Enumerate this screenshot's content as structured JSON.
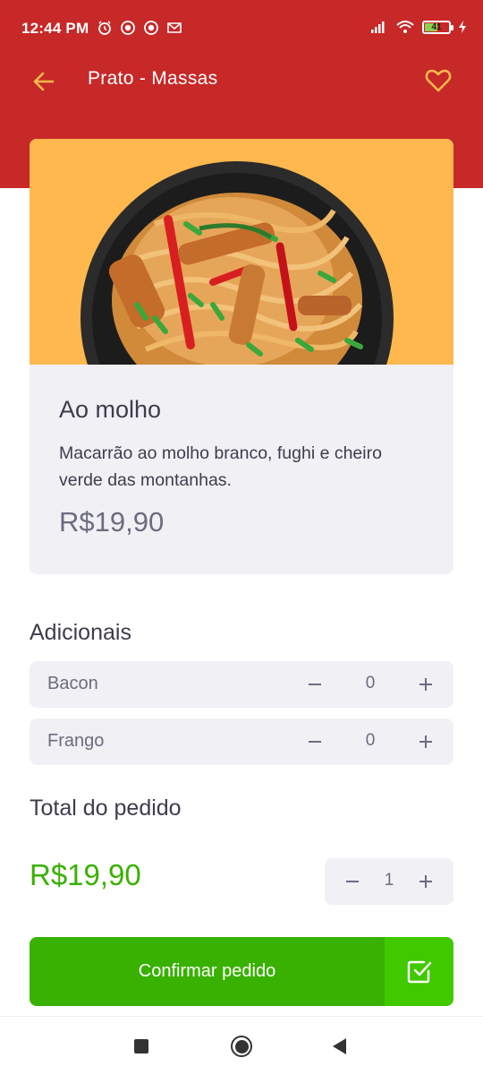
{
  "status_bar": {
    "time": "12:44 PM",
    "left_icons": [
      "alarm-icon",
      "vpn-icon",
      "vpn-icon",
      "gmail-icon"
    ],
    "right_icons": [
      "signal-icon",
      "wifi-icon",
      "battery-icon",
      "charging-icon"
    ],
    "battery_level": "41"
  },
  "header": {
    "title": "Prato - Massas",
    "back_icon": "arrow-left-icon",
    "favorite_icon": "heart-icon"
  },
  "product": {
    "image_alt": "pasta-dish-image",
    "name": "Ao molho",
    "description": "Macarrão ao molho branco, fughi e cheiro verde das montanhas.",
    "price": "R$19,90"
  },
  "extras": {
    "title": "Adicionais",
    "items": [
      {
        "label": "Bacon",
        "quantity": "0",
        "minus": "−",
        "plus": "+"
      },
      {
        "label": "Frango",
        "quantity": "0",
        "minus": "−",
        "plus": "+"
      }
    ]
  },
  "total": {
    "title": "Total do pedido",
    "value": "R$19,90",
    "quantity": "1",
    "minus": "−",
    "plus": "+"
  },
  "confirm": {
    "label": "Confirmar pedido",
    "icon": "check-square-icon"
  },
  "nav_bar": {
    "items": [
      "recent-apps-button",
      "home-button",
      "back-button"
    ]
  },
  "colors": {
    "header_red": "#c72828",
    "accent_yellow": "#ffb84d",
    "green": "#39b100",
    "green_light": "#41c900",
    "card_bg": "#f0f0f5",
    "text": "#3d3d4d",
    "muted": "#6c6c80"
  }
}
